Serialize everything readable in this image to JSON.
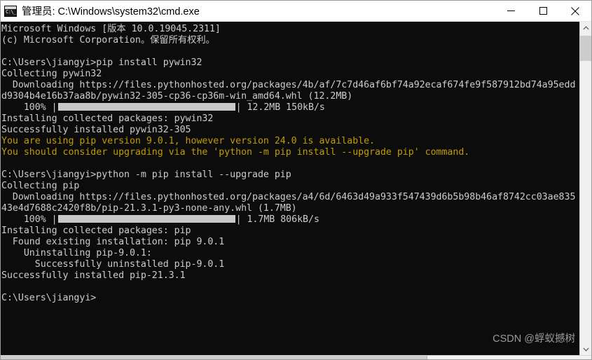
{
  "window": {
    "title": "管理员: C:\\Windows\\system32\\cmd.exe",
    "icon_glyph": "C:\\_",
    "icon_name": "cmd-console-icon",
    "controls": {
      "minimize_label": "最小化",
      "maximize_label": "最大化",
      "close_label": "关闭"
    },
    "colors": {
      "console_background": "#0c0c0c",
      "console_foreground": "#cccccc",
      "warning_foreground": "#c19c00",
      "progress_fill": "#c8c8c8",
      "titlebar_background": "#ffffff",
      "scrollbar_track": "#f0f0f0",
      "scrollbar_thumb": "#cdcdcd"
    }
  },
  "console": {
    "lines": [
      {
        "text": "Microsoft Windows [版本 10.0.19045.2311]",
        "style": "normal"
      },
      {
        "text": "(c) Microsoft Corporation。保留所有权利。",
        "style": "normal"
      },
      {
        "text": "",
        "style": "blank"
      },
      {
        "text": "C:\\Users\\jiangyi>pip install pywin32",
        "style": "normal"
      },
      {
        "text": "Collecting pywin32",
        "style": "normal"
      },
      {
        "text": "  Downloading https://files.pythonhosted.org/packages/4b/af/7c7d46af6bf74a92ecaf674fe9f587912bd74a95edd",
        "style": "normal"
      },
      {
        "text": "d9304b4e16b37aa8b/pywin32-305-cp36-cp36m-win_amd64.whl (12.2MB)",
        "style": "normal"
      },
      {
        "text": "    100% |",
        "style": "progress",
        "after": "| 12.2MB 150kB/s"
      },
      {
        "text": "Installing collected packages: pywin32",
        "style": "normal"
      },
      {
        "text": "Successfully installed pywin32-305",
        "style": "normal"
      },
      {
        "text": "You are using pip version 9.0.1, however version 24.0 is available.",
        "style": "warn"
      },
      {
        "text": "You should consider upgrading via the 'python -m pip install --upgrade pip' command.",
        "style": "warn"
      },
      {
        "text": "",
        "style": "blank"
      },
      {
        "text": "C:\\Users\\jiangyi>python -m pip install --upgrade pip",
        "style": "normal"
      },
      {
        "text": "Collecting pip",
        "style": "normal"
      },
      {
        "text": "  Downloading https://files.pythonhosted.org/packages/a4/6d/6463d49a933f547439d6b5b98b46af8742cc03ae835",
        "style": "normal"
      },
      {
        "text": "43e4d7688c2420f8b/pip-21.3.1-py3-none-any.whl (1.7MB)",
        "style": "normal"
      },
      {
        "text": "    100% |",
        "style": "progress",
        "after": "| 1.7MB 806kB/s"
      },
      {
        "text": "Installing collected packages: pip",
        "style": "normal"
      },
      {
        "text": "  Found existing installation: pip 9.0.1",
        "style": "normal"
      },
      {
        "text": "    Uninstalling pip-9.0.1:",
        "style": "normal"
      },
      {
        "text": "      Successfully uninstalled pip-9.0.1",
        "style": "normal"
      },
      {
        "text": "Successfully installed pip-21.3.1",
        "style": "normal"
      },
      {
        "text": "",
        "style": "blank"
      },
      {
        "text": "C:\\Users\\jiangyi>",
        "style": "normal"
      }
    ]
  },
  "watermark": {
    "text": "CSDN @蜉蚁撼树"
  }
}
